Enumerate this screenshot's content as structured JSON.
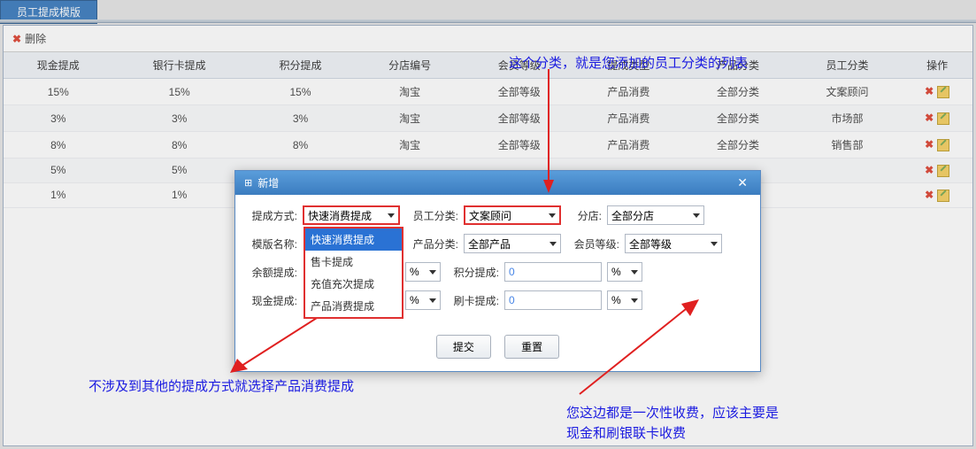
{
  "page_tab": "员工提成模版",
  "toolbar": {
    "delete": "删除"
  },
  "table": {
    "headers": [
      "现金提成",
      "银行卡提成",
      "积分提成",
      "分店编号",
      "会员等级",
      "提成类型",
      "产品分类",
      "员工分类",
      "操作"
    ],
    "rows": [
      [
        "15%",
        "15%",
        "15%",
        "淘宝",
        "全部等级",
        "产品消费",
        "全部分类",
        "文案顾问"
      ],
      [
        "3%",
        "3%",
        "3%",
        "淘宝",
        "全部等级",
        "产品消费",
        "全部分类",
        "市场部"
      ],
      [
        "8%",
        "8%",
        "8%",
        "淘宝",
        "全部等级",
        "产品消费",
        "全部分类",
        "销售部"
      ],
      [
        "5%",
        "5%",
        "",
        "",
        "",
        "",
        "",
        ""
      ],
      [
        "1%",
        "1%",
        "",
        "",
        "",
        "",
        "",
        ""
      ]
    ]
  },
  "modal": {
    "title": "新增",
    "labels": {
      "tcfs": "提成方式:",
      "ygfl": "员工分类:",
      "fd": "分店:",
      "mbmc": "模版名称:",
      "cpfl": "产品分类:",
      "hydj": "会员等级:",
      "yetc": "余额提成:",
      "jftc": "积分提成:",
      "xjtc": "现金提成:",
      "sktc": "刷卡提成:"
    },
    "selects": {
      "tcfs": "快速消费提成",
      "ygfl": "文案顾问",
      "fd": "全部分店",
      "cpfl": "全部产品",
      "hydj": "全部等级",
      "unit1": "%",
      "unit2": "%",
      "unit3": "%",
      "unit4": "%"
    },
    "dropdown_options": [
      "快速消费提成",
      "售卡提成",
      "充值充次提成",
      "产品消费提成"
    ],
    "inputs": {
      "jftc": "0",
      "sktc": "0",
      "yetc": "",
      "xjtc": "",
      "mbmc": ""
    },
    "buttons": {
      "submit": "提交",
      "reset": "重置"
    }
  },
  "annotations": {
    "top": "这个分类，就是您添加的员工分类的列表",
    "left": "不涉及到其他的提成方式就选择产品消费提成",
    "right1": "您这边都是一次性收费，应该主要是",
    "right2": "现金和刷银联卡收费"
  }
}
